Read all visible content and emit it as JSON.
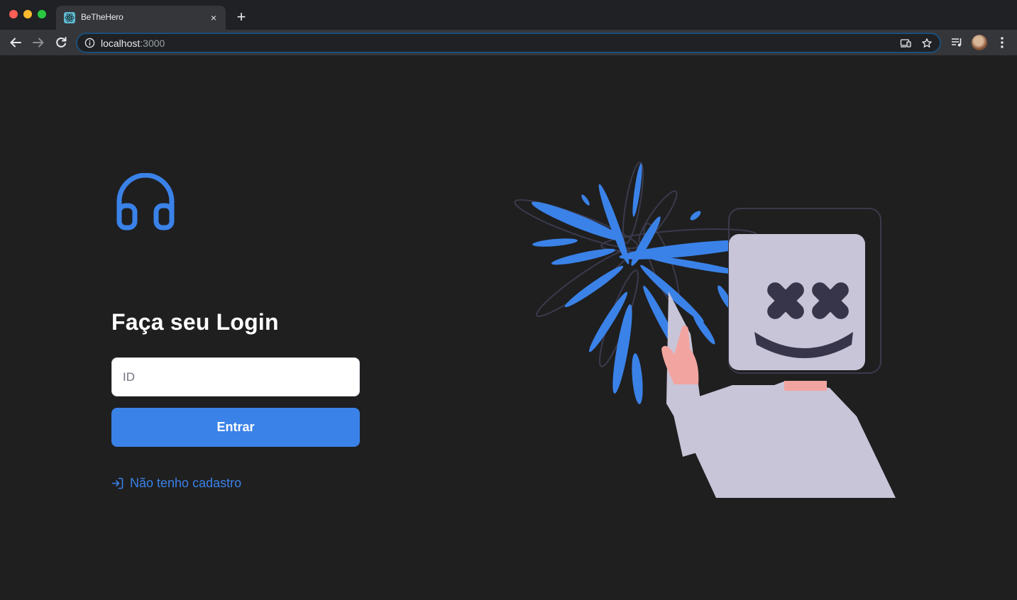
{
  "browser": {
    "tab_title": "BeTheHero",
    "tab_close": "×",
    "new_tab": "+",
    "url_host": "localhost",
    "url_port": ":3000"
  },
  "page": {
    "login_title": "Faça seu Login",
    "id_placeholder": "ID",
    "id_value": "",
    "enter_label": "Entrar",
    "register_link": "Não tenho cadastro"
  },
  "colors": {
    "accent": "#3a82e8",
    "background": "#1f1f20",
    "mascot_body": "#c8c5d9",
    "mascot_dark": "#373549"
  },
  "icons": {
    "logo": "headphones-icon",
    "register": "log-in-icon",
    "favicon": "react-icon"
  }
}
